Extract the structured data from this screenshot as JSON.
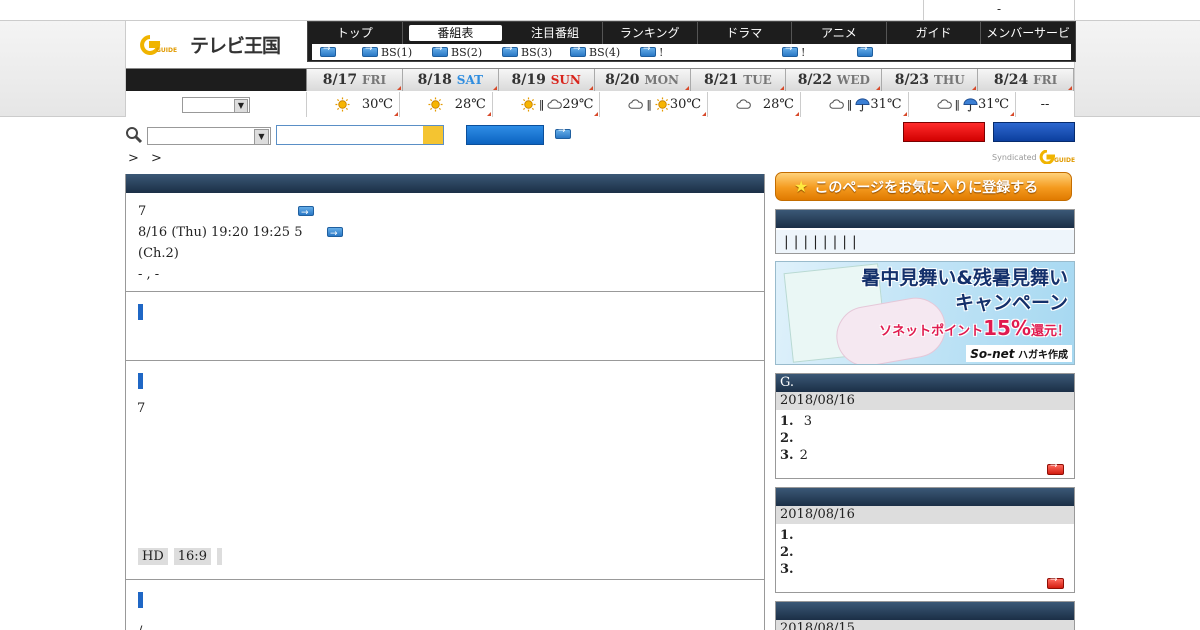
{
  "topbar": {
    "right_text": "-"
  },
  "logo": {
    "text": "テレビ王国",
    "g_text": "GUIDE"
  },
  "nav": {
    "items": [
      "トップ",
      "番組表",
      "注目番組",
      "ランキング",
      "ドラマ",
      "アニメ",
      "ガイド",
      "メンバーサービス"
    ],
    "active_index": 1,
    "sub": [
      "",
      "BS(1)",
      "BS(2)",
      "BS(3)",
      "BS(4)",
      "!",
      "!",
      ""
    ]
  },
  "dates": [
    {
      "date": "8/17",
      "dow": "FRI",
      "kind": "wd"
    },
    {
      "date": "8/18",
      "dow": "SAT",
      "kind": "sat"
    },
    {
      "date": "8/19",
      "dow": "SUN",
      "kind": "sun"
    },
    {
      "date": "8/20",
      "dow": "MON",
      "kind": "wd"
    },
    {
      "date": "8/21",
      "dow": "TUE",
      "kind": "wd"
    },
    {
      "date": "8/22",
      "dow": "WED",
      "kind": "wd"
    },
    {
      "date": "8/23",
      "dow": "THU",
      "kind": "wd"
    },
    {
      "date": "8/24",
      "dow": "FRI",
      "kind": "wd"
    }
  ],
  "weather": [
    {
      "icons": [
        "sun-icon"
      ],
      "temp": "30℃"
    },
    {
      "icons": [
        "sun-icon"
      ],
      "temp": "28℃"
    },
    {
      "icons": [
        "sun-icon",
        "cloud-icon"
      ],
      "temp": "29℃"
    },
    {
      "icons": [
        "cloud-icon",
        "sun-icon"
      ],
      "temp": "30℃"
    },
    {
      "icons": [
        "cloud-icon"
      ],
      "temp": "28℃"
    },
    {
      "icons": [
        "cloud-icon",
        "umbrella-icon"
      ],
      "temp": "31℃"
    },
    {
      "icons": [
        "cloud-icon",
        "umbrella-icon"
      ],
      "temp": "31℃"
    },
    {
      "icons": [],
      "temp": "--"
    }
  ],
  "search": {
    "select_value": "",
    "query": ""
  },
  "breadcrumb": [
    ">",
    ">"
  ],
  "syndicated": {
    "label": "Syndicated",
    "brand": "GUIDE"
  },
  "program": {
    "line1": "7",
    "line2": "8/16 (Thu) 19:20  19:25 5",
    "line3": "(Ch.2)",
    "line4": " -    ,  -",
    "sec3_text": "7",
    "tags": [
      "HD",
      "16:9"
    ],
    "sec4_text": "/"
  },
  "sidebar": {
    "fav_label": "このページをお気に入りに登録する",
    "pipes": "||||||||",
    "banner": {
      "title1": "暑中見舞い&残暑見舞い",
      "title2": "キャンペーン",
      "sub_prefix": "ソネットポイント",
      "sub_pct": "15%",
      "sub_suffix": "還元！",
      "foot_brand": "So-net",
      "foot_text": "ハガキ作成"
    },
    "rank_g": {
      "title": "G.",
      "date": "2018/08/16",
      "items": [
        {
          "n": "1.",
          "t": " 3"
        },
        {
          "n": "2.",
          "t": ""
        },
        {
          "n": "3.",
          "t": "2"
        }
      ]
    },
    "rank_2": {
      "title": "",
      "date": "2018/08/16",
      "items": [
        {
          "n": "1.",
          "t": ""
        },
        {
          "n": "2.",
          "t": ""
        },
        {
          "n": "3.",
          "t": ""
        }
      ]
    },
    "rank_3": {
      "title": "",
      "date": "2018/08/15"
    }
  }
}
